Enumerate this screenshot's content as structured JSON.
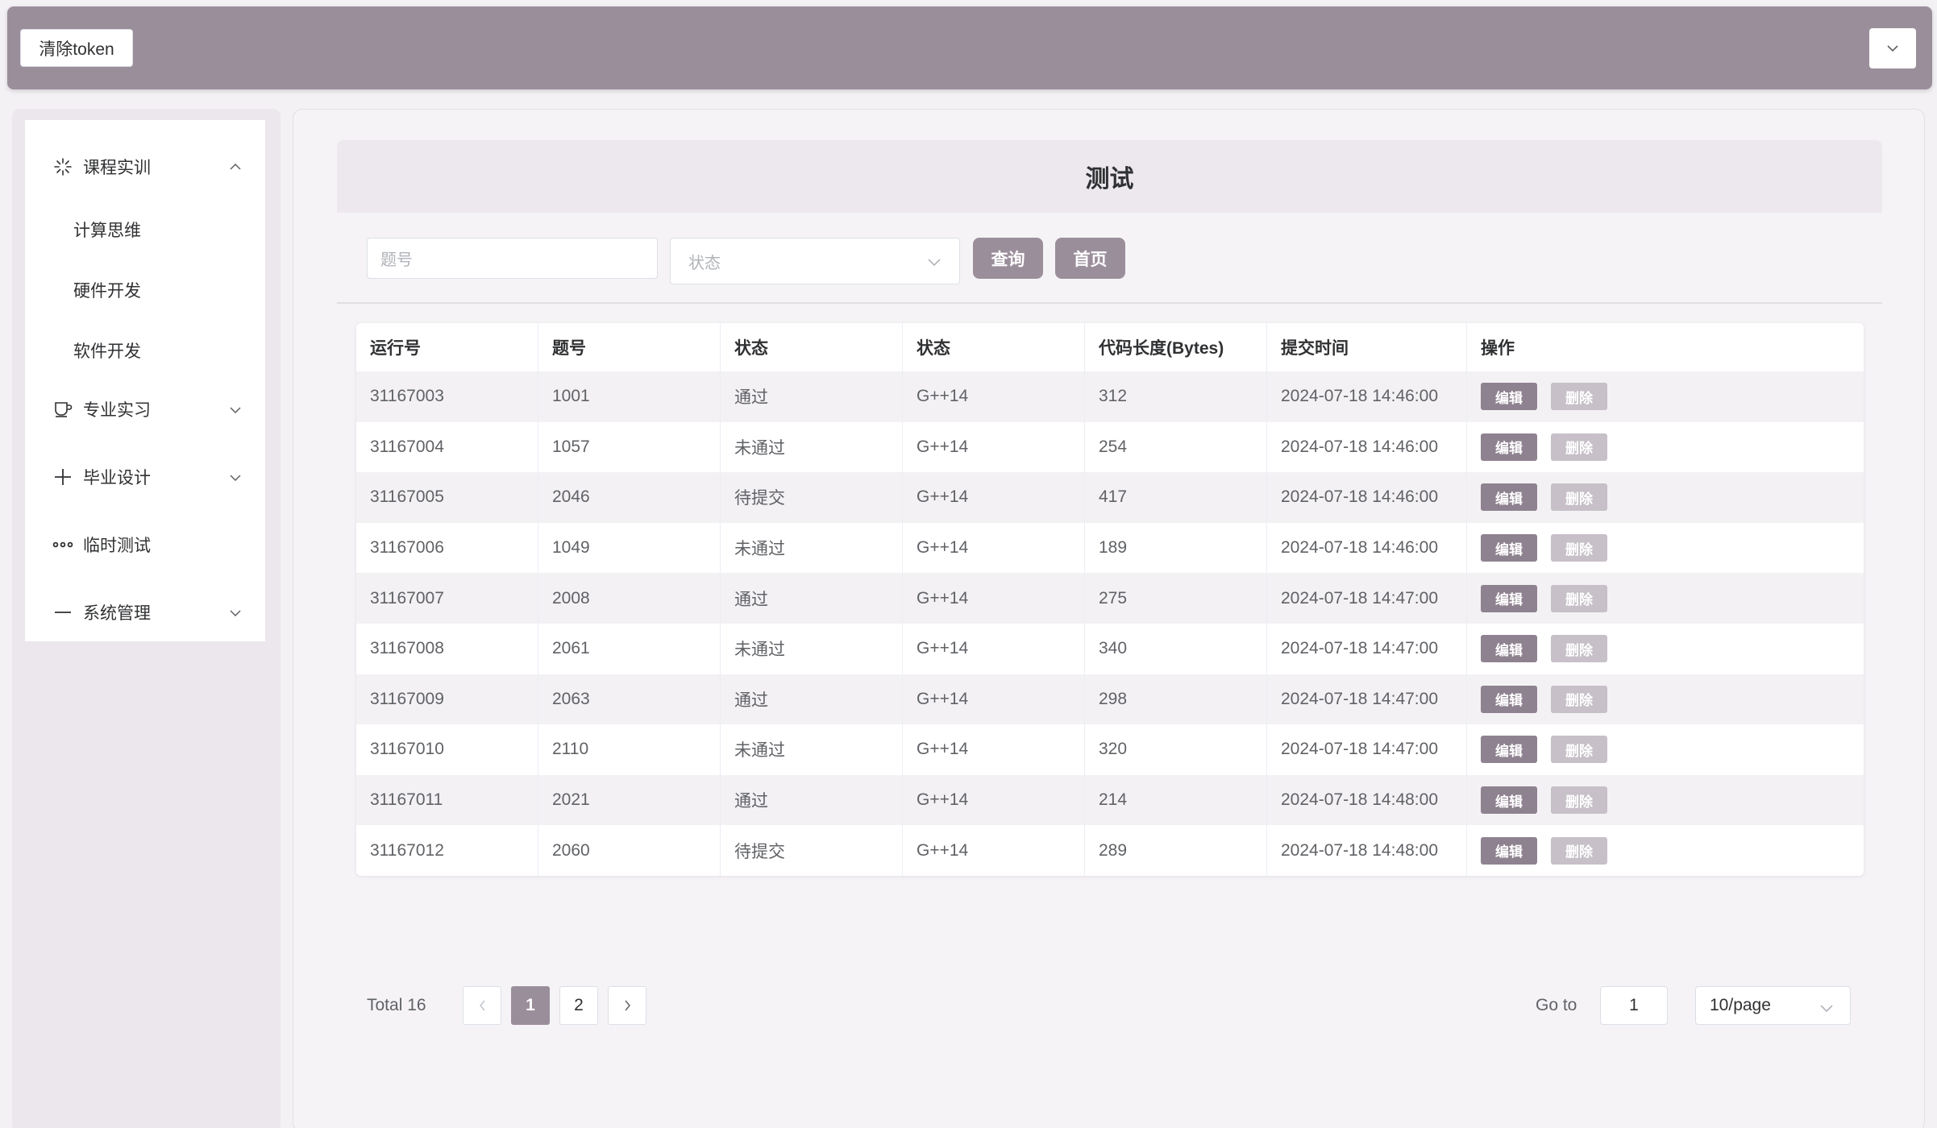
{
  "header": {
    "clear_token_label": "清除token",
    "dropdown_icon": "chevron-down-icon"
  },
  "sidebar": {
    "groups": [
      {
        "label": "课程实训",
        "icon": "loading-icon",
        "expanded": true,
        "children": [
          "计算思维",
          "硬件开发",
          "软件开发"
        ]
      },
      {
        "label": "专业实习",
        "icon": "coffee-cup-icon",
        "expanded": false
      },
      {
        "label": "毕业设计",
        "icon": "plus-icon",
        "expanded": false
      },
      {
        "label": "临时测试",
        "icon": "more-icon",
        "expanded": null
      },
      {
        "label": "系统管理",
        "icon": "minus-icon",
        "expanded": false
      }
    ]
  },
  "main": {
    "title": "测试",
    "search": {
      "problem_placeholder": "题号",
      "status_placeholder": "状态",
      "query_label": "查询",
      "home_label": "首页"
    },
    "table": {
      "columns": [
        "运行号",
        "题号",
        "状态",
        "状态",
        "代码长度(Bytes)",
        "提交时间",
        "操作"
      ],
      "actions": {
        "edit": "编辑",
        "delete": "删除"
      },
      "rows": [
        [
          "31167003",
          "1001",
          "通过",
          "G++14",
          "312",
          "2024-07-18 14:46:00"
        ],
        [
          "31167004",
          "1057",
          "未通过",
          "G++14",
          "254",
          "2024-07-18 14:46:00"
        ],
        [
          "31167005",
          "2046",
          "待提交",
          "G++14",
          "417",
          "2024-07-18 14:46:00"
        ],
        [
          "31167006",
          "1049",
          "未通过",
          "G++14",
          "189",
          "2024-07-18 14:46:00"
        ],
        [
          "31167007",
          "2008",
          "通过",
          "G++14",
          "275",
          "2024-07-18 14:47:00"
        ],
        [
          "31167008",
          "2061",
          "未通过",
          "G++14",
          "340",
          "2024-07-18 14:47:00"
        ],
        [
          "31167009",
          "2063",
          "通过",
          "G++14",
          "298",
          "2024-07-18 14:47:00"
        ],
        [
          "31167010",
          "2110",
          "未通过",
          "G++14",
          "320",
          "2024-07-18 14:47:00"
        ],
        [
          "31167011",
          "2021",
          "通过",
          "G++14",
          "214",
          "2024-07-18 14:48:00"
        ],
        [
          "31167012",
          "2060",
          "待提交",
          "G++14",
          "289",
          "2024-07-18 14:48:00"
        ]
      ]
    },
    "pagination": {
      "total_label": "Total 16",
      "pages": [
        "1",
        "2"
      ],
      "current_page": "1",
      "goto_label": "Go to",
      "goto_value": "1",
      "page_size": "10/page"
    }
  },
  "colors": {
    "accent": "#9b8e9b",
    "accent_dark": "#8f8290",
    "accent_light": "#c7c0c8"
  }
}
